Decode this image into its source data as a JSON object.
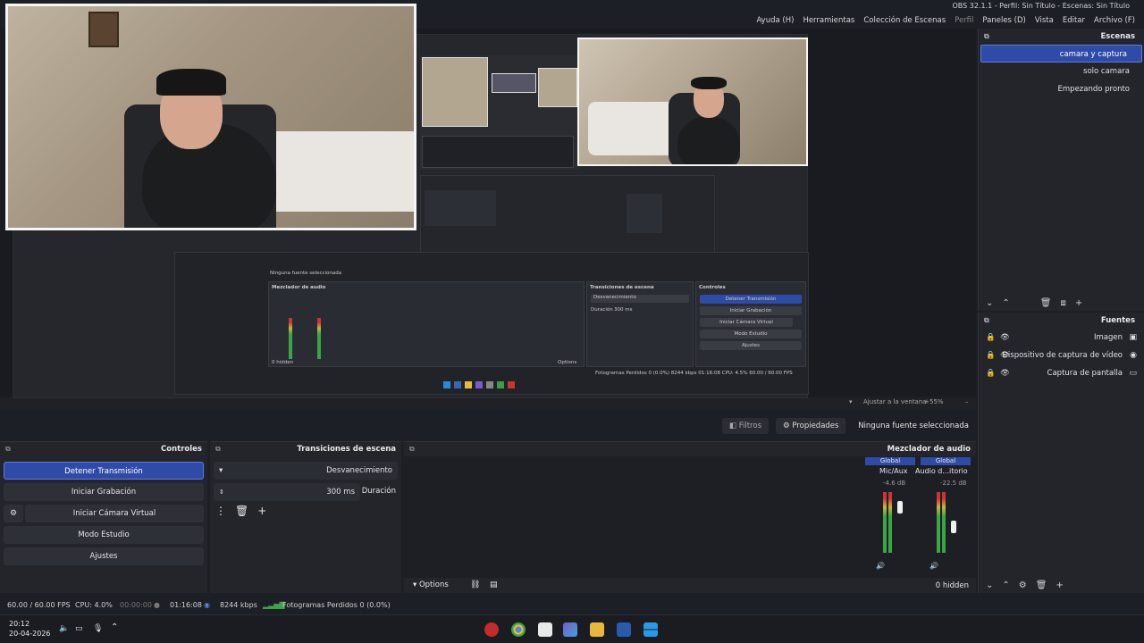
{
  "window": {
    "title": "OBS 32.1.1 - Perfil: Sin Título - Escenas: Sin Título"
  },
  "menu": [
    "Archivo (F)",
    "Editar",
    "Vista",
    "Paneles (D)",
    "Perfil",
    "Colección de Escenas",
    "Herramientas",
    "Ayuda (H)"
  ],
  "context_bar": {
    "zoom_label": "Ajustar a la ventana",
    "zoom_value": "55%"
  },
  "scenes": {
    "title": "Escenas",
    "items": [
      "camara y captura",
      "solo camara",
      "Empezando pronto"
    ],
    "selected_index": 0
  },
  "sources": {
    "title": "Fuentes",
    "items": [
      {
        "label": "Imagen",
        "icon": "image-icon"
      },
      {
        "label": "Dispositivo de captura de vídeo",
        "icon": "camera-icon"
      },
      {
        "label": "Captura de pantalla",
        "icon": "monitor-icon"
      }
    ]
  },
  "properties_bar": {
    "no_source": "Ninguna fuente seleccionada",
    "properties": "Propiedades",
    "filters": "Filtros"
  },
  "audio_mixer": {
    "title": "Mezclador de audio",
    "channels": [
      {
        "name": "Audio d...itorio",
        "badge": "Global",
        "db": "-22.5 dB",
        "level": 0.55
      },
      {
        "name": "Mic/Aux",
        "badge": "Global",
        "db": "-4.6 dB",
        "level": 0.75
      }
    ],
    "hidden_label": "0 hidden",
    "options_label": "Options"
  },
  "transitions": {
    "title": "Transiciones de escena",
    "type": "Desvanecimiento",
    "duration_label": "Duración",
    "duration_value": "300 ms"
  },
  "controls": {
    "title": "Controles",
    "buttons": [
      "Detener Transmisión",
      "Iniciar Grabación",
      "Iniciar Cámara Virtual",
      "Modo Estudio",
      "Ajustes"
    ]
  },
  "status": {
    "dropped": "Fotogramas Perdidos 0 (0.0%)",
    "bitrate": "8244 kbps",
    "stream_time": "01:16:08",
    "rec_time": "00:00:00",
    "cpu": "CPU: 4.0%",
    "fps": "60.00 / 60.00 FPS"
  },
  "clock": {
    "time": "20:12",
    "date": "20-04-2026"
  },
  "inner_preview": {
    "no_source": "Ninguna fuente seleccionada",
    "mixer": "Mezclador de audio",
    "transitions": "Transiciones de escena",
    "controls": "Controles",
    "fade": "Desvanecimiento",
    "duration": "Duración",
    "duration_value": "300 ms",
    "btns": [
      "Detener Transmisión",
      "Iniciar Grabación",
      "Iniciar Cámara Virtual",
      "Modo Estudio",
      "Ajustes"
    ],
    "status": "Fotogramas Perdidos 0 (0.0%)   8244 kbps   01:16:08   CPU: 4.5%   60.00 / 60.00 FPS",
    "hidden": "0 hidden",
    "options": "Options"
  }
}
